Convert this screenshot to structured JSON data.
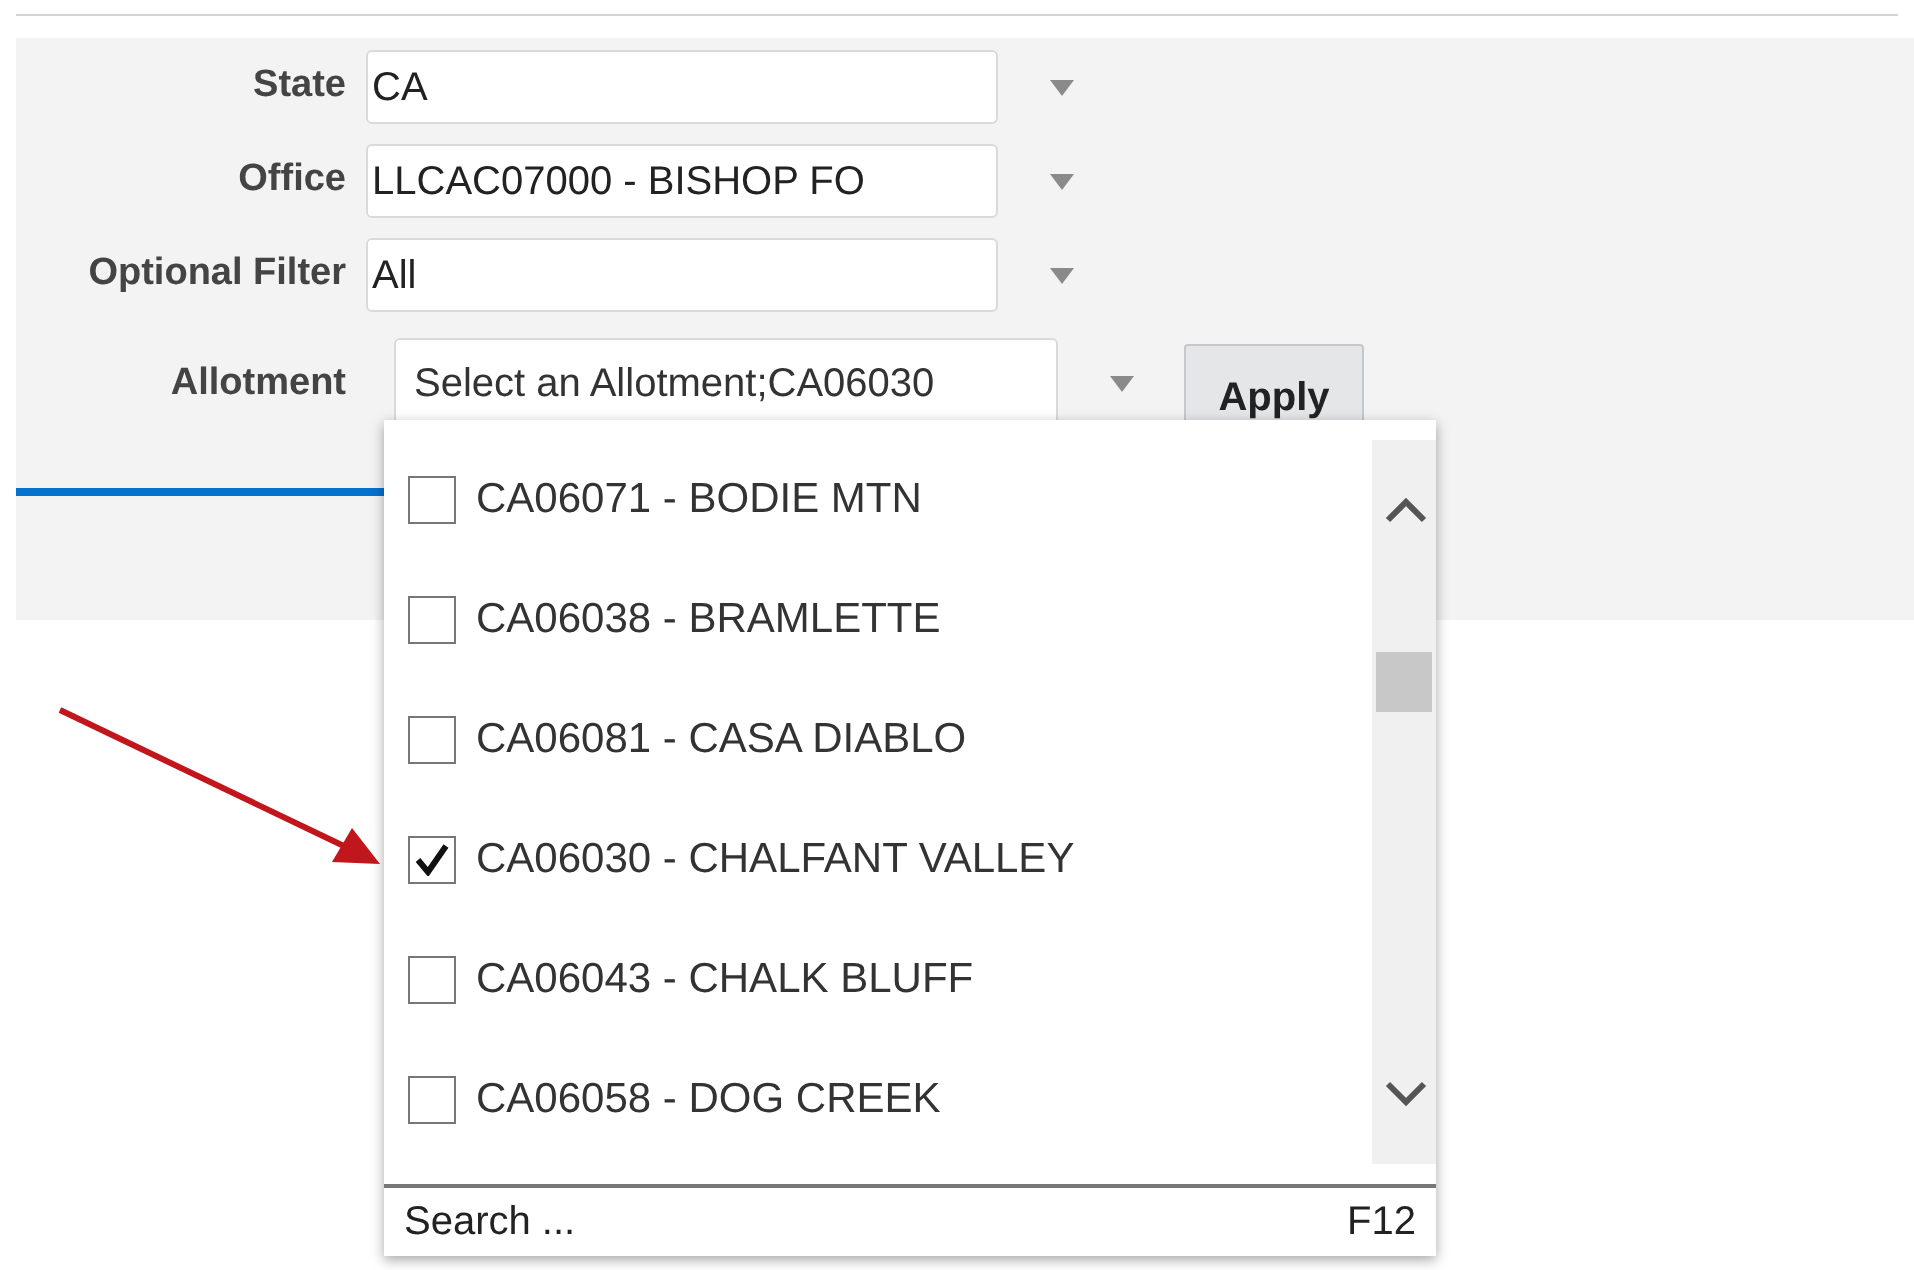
{
  "filters": [
    {
      "label": "State",
      "value": "CA"
    },
    {
      "label": "Office",
      "value": "LLCAC07000 - BISHOP FO"
    },
    {
      "label": "Optional Filter",
      "value": "All"
    }
  ],
  "allotment": {
    "label": "Allotment",
    "value": "Select an Allotment;CA06030",
    "expanded": true
  },
  "apply_button": "Apply",
  "options": [
    {
      "label": "CA06071 - BODIE MTN",
      "checked": false
    },
    {
      "label": "CA06038 - BRAMLETTE",
      "checked": false
    },
    {
      "label": "CA06081 - CASA DIABLO",
      "checked": false
    },
    {
      "label": "CA06030 - CHALFANT VALLEY",
      "checked": true
    },
    {
      "label": "CA06043 - CHALK BLUFF",
      "checked": false
    },
    {
      "label": "CA06058 - DOG CREEK",
      "checked": false
    }
  ],
  "search": {
    "placeholder": "Search ...",
    "shortcut": "F12"
  }
}
